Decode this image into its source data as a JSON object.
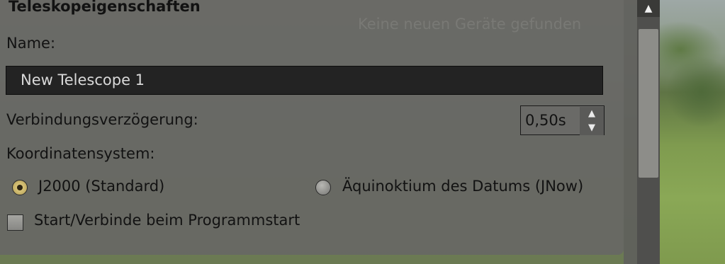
{
  "dialog": {
    "title": "Teleskopeigenschaften",
    "background_hint": "Keine neuen Geräte gefunden"
  },
  "name_field": {
    "label": "Name:",
    "value": "New Telescope 1"
  },
  "delay": {
    "label": "Verbindungsverzögerung:",
    "value": "0,50s"
  },
  "coordinates": {
    "label": "Koordinatensystem:",
    "options": [
      {
        "label": "J2000 (Standard)",
        "selected": true
      },
      {
        "label": "Äquinoktium des Datums (JNow)",
        "selected": false
      }
    ]
  },
  "startup": {
    "label": "Start/Verbinde beim Programmstart",
    "checked": false
  },
  "icons": {
    "spin_up": "▲",
    "spin_down": "▼",
    "scroll_up": "▲"
  },
  "colors": {
    "panel": "#676764",
    "field": "#232323",
    "radio_selected": "#e9d487"
  }
}
